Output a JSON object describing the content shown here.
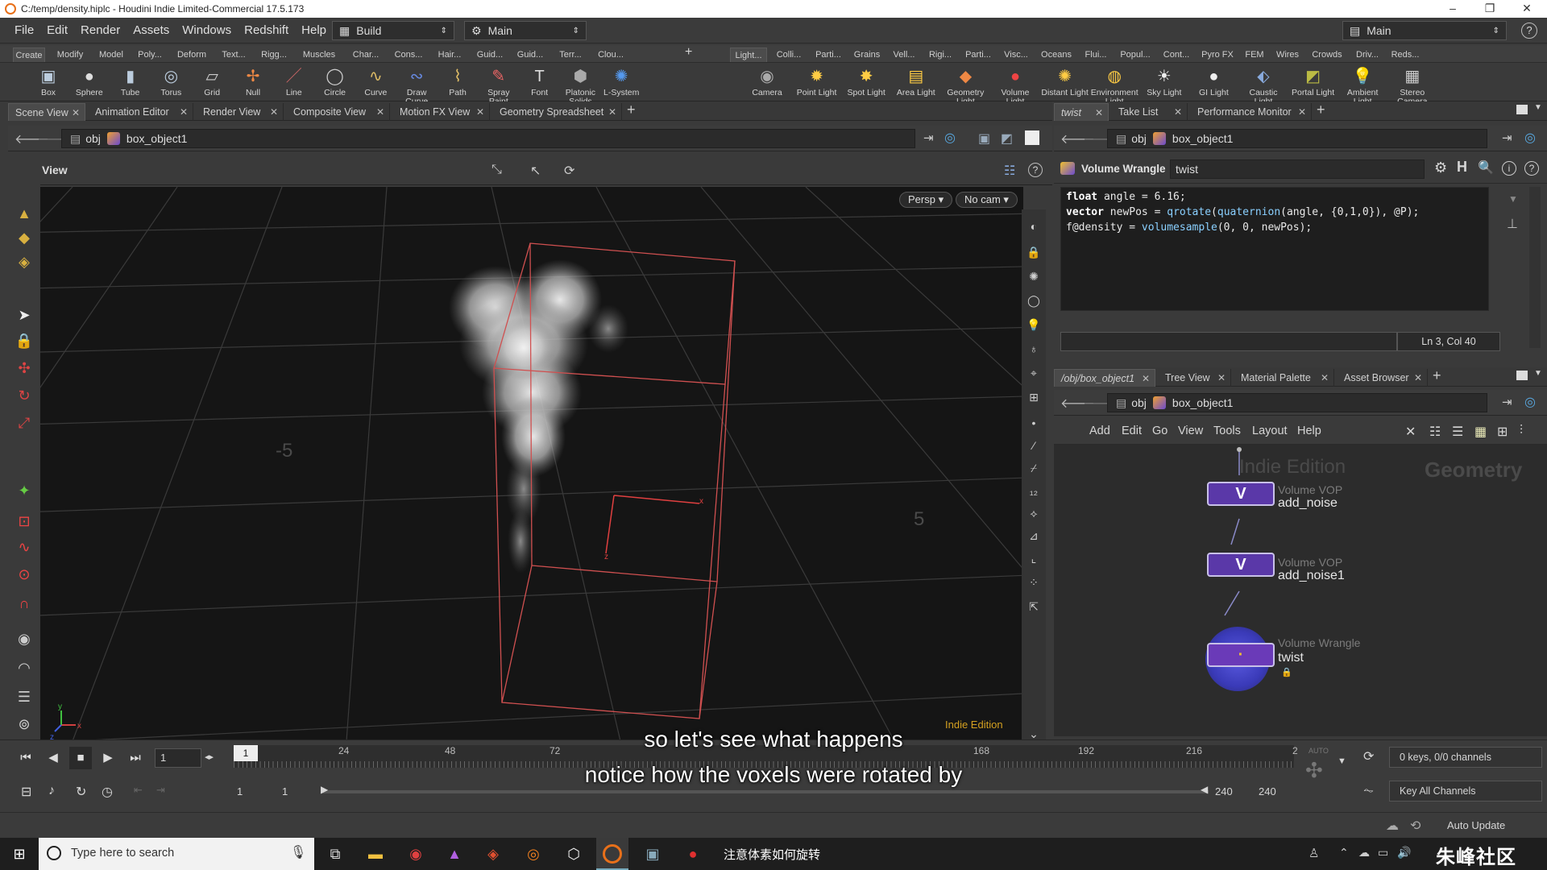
{
  "window": {
    "title": "C:/temp/density.hiplc - Houdini Indie Limited-Commercial 17.5.173"
  },
  "menu": [
    "File",
    "Edit",
    "Render",
    "Assets",
    "Windows",
    "Redshift",
    "Help"
  ],
  "desktops": {
    "build": "Build",
    "main": "Main",
    "right_main": "Main"
  },
  "shelf_tabs_left": [
    "Create",
    "Modify",
    "Model",
    "Poly...",
    "Deform",
    "Text...",
    "Rigg...",
    "Muscles",
    "Char...",
    "Cons...",
    "Hair...",
    "Guid...",
    "Guid...",
    "Terr...",
    "Clou..."
  ],
  "shelf_tabs_right": [
    "Light...",
    "Colli...",
    "Parti...",
    "Grains",
    "Vell...",
    "Rigi...",
    "Parti...",
    "Visc...",
    "Oceans",
    "Flui...",
    "Popul...",
    "Cont...",
    "Pyro FX",
    "FEM",
    "Wires",
    "Crowds",
    "Driv...",
    "Reds..."
  ],
  "tools_left": [
    "Box",
    "Sphere",
    "Tube",
    "Torus",
    "Grid",
    "Null",
    "Line",
    "Circle",
    "Curve",
    "Draw Curve",
    "Path",
    "Spray Paint",
    "Font",
    "Platonic Solids",
    "L-System"
  ],
  "tools_right": [
    "Camera",
    "Point Light",
    "Spot Light",
    "Area Light",
    "Geometry Light",
    "Volume Light",
    "Distant Light",
    "Environment Light",
    "Sky Light",
    "GI Light",
    "Caustic Light",
    "Portal Light",
    "Ambient Light",
    "Stereo Camera"
  ],
  "left_tabs": [
    "Scene View",
    "Animation Editor",
    "Render View",
    "Composite View",
    "Motion FX View",
    "Geometry Spreadsheet"
  ],
  "left_path": {
    "context": "obj",
    "node": "box_object1"
  },
  "viewport": {
    "label": "View",
    "persp": "Persp",
    "cam": "No cam",
    "edition": "Indie Edition",
    "grid_left": "-5",
    "grid_right": "5",
    "axis_x": "x",
    "axis_y": "y",
    "axis_z": "z"
  },
  "param_tabs": [
    "twist",
    "Take List",
    "Performance Monitor"
  ],
  "param_path": {
    "context": "obj",
    "node": "box_object1"
  },
  "wrangle": {
    "type": "Volume Wrangle",
    "name": "twist",
    "status": "Ln 3, Col 40"
  },
  "code": {
    "l1_kw": "float",
    "l1_rest": " angle = 6.16;",
    "l2_kw": "vector",
    "l2_a": " newPos = ",
    "l2_f1": "qrotate",
    "l2_b": "(",
    "l2_f2": "quaternion",
    "l2_c": "(angle, {0,1,0}), @P);",
    "l3_a": "f@density = ",
    "l3_f": "volumesample",
    "l3_b": "(0, 0, newPos);"
  },
  "net_tabs": [
    "/obj/box_object1",
    "Tree View",
    "Material Palette",
    "Asset Browser"
  ],
  "net_path": {
    "context": "obj",
    "node": "box_object1"
  },
  "net_menu": [
    "Add",
    "Edit",
    "Go",
    "View",
    "Tools",
    "Layout",
    "Help"
  ],
  "net_watermark": {
    "edition": "Indie Edition",
    "context": "Geometry"
  },
  "nodes": [
    {
      "type": "Volume VOP",
      "name": "add_noise",
      "glyph": "V"
    },
    {
      "type": "Volume VOP",
      "name": "add_noise1",
      "glyph": "V"
    },
    {
      "type": "Volume Wrangle",
      "name": "twist",
      "glyph": "·"
    }
  ],
  "timeline": {
    "current_frame": "1",
    "marker": "1",
    "ticks": [
      "24",
      "48",
      "72",
      "168",
      "192",
      "216",
      "2"
    ],
    "range_start": "1",
    "range_start2": "1",
    "range_end": "240",
    "range_end2": "240",
    "keys": "0 keys, 0/0 channels",
    "key_all": "Key All Channels",
    "auto_update": "Auto Update",
    "auto_label": "AUTO"
  },
  "taskbar": {
    "search": "Type here to search",
    "window_title": "注意体素如何旋转",
    "watermark": "朱峰社区"
  },
  "subtitles": [
    "so let's see what happens",
    "notice how the voxels were rotated by"
  ],
  "colors": {
    "node_purple": "#5a38a8",
    "bbox_red": "#d05050",
    "accent_yellow": "#d8b040"
  }
}
